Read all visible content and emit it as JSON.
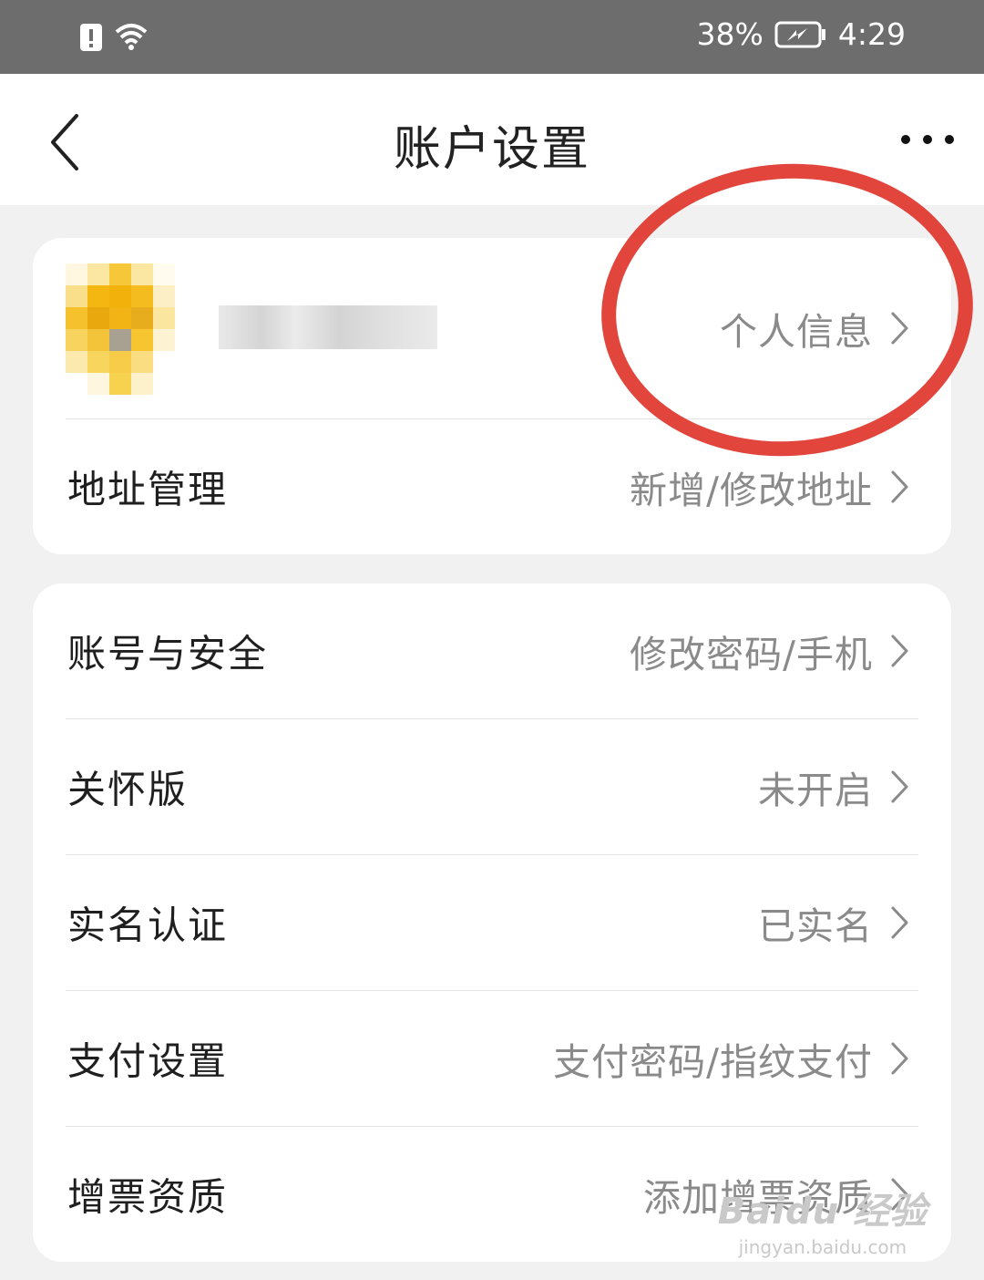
{
  "status_bar": {
    "battery_percent": "38%",
    "time": "4:29"
  },
  "header": {
    "title": "账户设置"
  },
  "profile_card": {
    "link_label": "个人信息",
    "rows": [
      {
        "label": "地址管理",
        "value": "新增/修改地址"
      }
    ]
  },
  "settings_card": {
    "rows": [
      {
        "label": "账号与安全",
        "value": "修改密码/手机"
      },
      {
        "label": "关怀版",
        "value": "未开启"
      },
      {
        "label": "实名认证",
        "value": "已实名"
      },
      {
        "label": "支付设置",
        "value": "支付密码/指纹支付"
      },
      {
        "label": "增票资质",
        "value": "添加增票资质"
      }
    ]
  },
  "watermark": {
    "brand": "Baidu 经验",
    "url": "jingyan.baidu.com"
  },
  "colors": {
    "annotation": "#e0352b",
    "status_bar_bg": "#6d6d6d",
    "page_bg": "#f1f1f1"
  }
}
